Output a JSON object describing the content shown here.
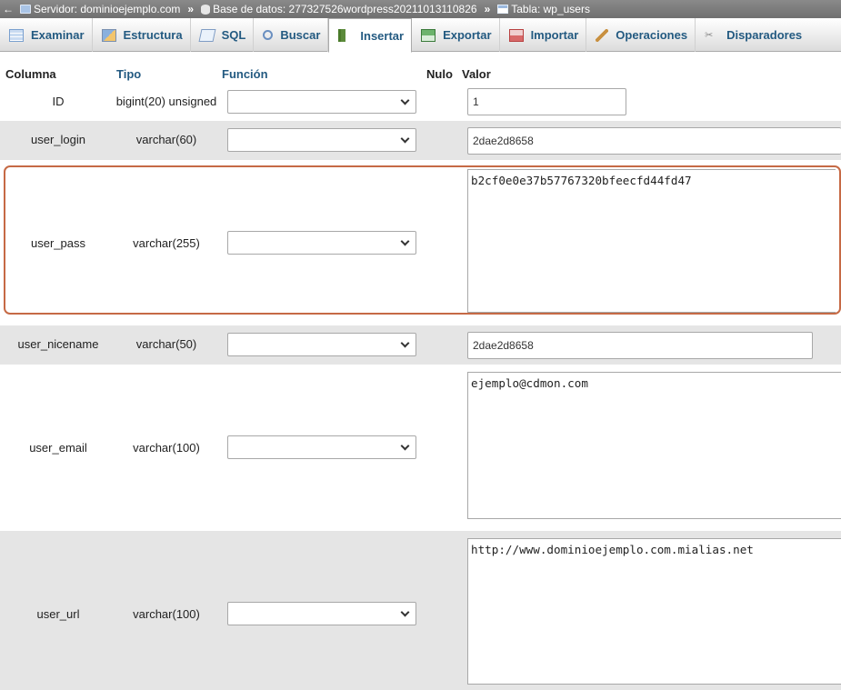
{
  "breadcrumb": {
    "back": "←",
    "server": "Servidor: dominioejemplo.com",
    "database": "Base de datos: 277327526wordpress20211013110826",
    "table": "Tabla: wp_users",
    "separator": "»"
  },
  "tabs": [
    {
      "label": "Examinar",
      "icon": "browse-icon"
    },
    {
      "label": "Estructura",
      "icon": "structure-icon"
    },
    {
      "label": "SQL",
      "icon": "sql-icon"
    },
    {
      "label": "Buscar",
      "icon": "search-icon"
    },
    {
      "label": "Insertar",
      "icon": "insert-icon",
      "active": true
    },
    {
      "label": "Exportar",
      "icon": "export-icon"
    },
    {
      "label": "Importar",
      "icon": "import-icon"
    },
    {
      "label": "Operaciones",
      "icon": "operations-icon"
    },
    {
      "label": "Disparadores",
      "icon": "triggers-icon"
    }
  ],
  "columns_header": {
    "columna": "Columna",
    "tipo": "Tipo",
    "funcion": "Función",
    "nulo": "Nulo",
    "valor": "Valor"
  },
  "rows": [
    {
      "name": "ID",
      "type": "bigint(20) unsigned",
      "function": "",
      "value": "1"
    },
    {
      "name": "user_login",
      "type": "varchar(60)",
      "function": "",
      "value": "2dae2d8658"
    },
    {
      "name": "user_pass",
      "type": "varchar(255)",
      "function": "",
      "value": "b2cf0e0e37b57767320bfeecfd44fd47"
    },
    {
      "name": "user_nicename",
      "type": "varchar(50)",
      "function": "",
      "value": "2dae2d8658"
    },
    {
      "name": "user_email",
      "type": "varchar(100)",
      "function": "",
      "value": "ejemplo@cdmon.com"
    },
    {
      "name": "user_url",
      "type": "varchar(100)",
      "function": "",
      "value": "http://www.dominioejemplo.com.mialias.net"
    }
  ],
  "colors": {
    "tab_text": "#235a81",
    "row_alt": "#e5e5e5",
    "highlight_border": "#c66a45"
  }
}
